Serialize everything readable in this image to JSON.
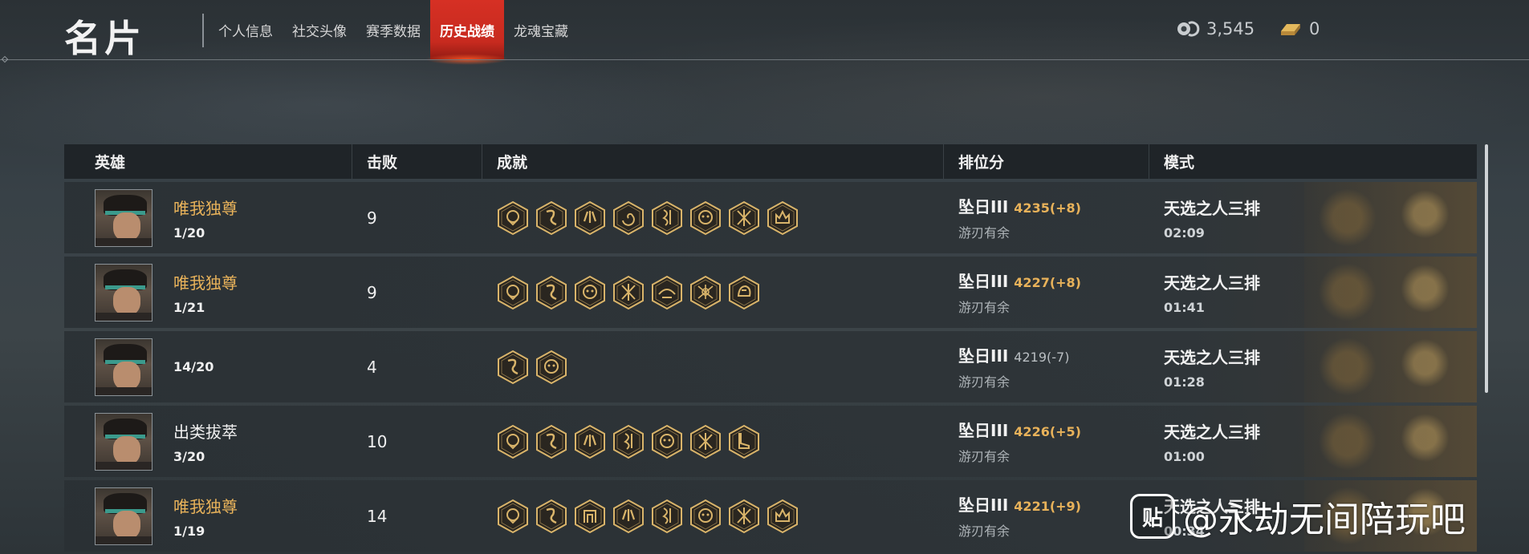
{
  "header": {
    "title": "名片",
    "tabs": [
      {
        "label": "个人信息",
        "active": false
      },
      {
        "label": "社交头像",
        "active": false
      },
      {
        "label": "赛季数据",
        "active": false
      },
      {
        "label": "历史战绩",
        "active": true
      },
      {
        "label": "龙魂宝藏",
        "active": false
      }
    ],
    "currency": {
      "jade": {
        "icon": "jade-coin-icon",
        "value": "3,545"
      },
      "gold": {
        "icon": "gold-ingot-icon",
        "value": "0"
      }
    }
  },
  "table": {
    "columns": {
      "hero": "英雄",
      "kills": "击败",
      "achievements": "成就",
      "rank": "排位分",
      "mode": "模式"
    },
    "rows": [
      {
        "title": "唯我独尊",
        "title_highlight": true,
        "placement": "1/20",
        "kills": "9",
        "badges": [
          "mask-badge-icon",
          "dragon-badge-icon",
          "claw-badge-icon",
          "swirl-badge-icon",
          "serpent-badge-icon",
          "beast-badge-icon",
          "cross-blades-badge-icon",
          "crown-badge-icon"
        ],
        "rank": "坠日III",
        "score": "4235(+8)",
        "score_up": true,
        "rank_sub": "游刃有余",
        "mode": "天选之人三排",
        "duration": "02:09"
      },
      {
        "title": "唯我独尊",
        "title_highlight": true,
        "placement": "1/21",
        "kills": "9",
        "badges": [
          "mask-badge-icon",
          "dragon-badge-icon",
          "beast-badge-icon",
          "cross-blades-badge-icon",
          "wings-badge-icon",
          "crossed-spears-badge-icon",
          "tiger-badge-icon"
        ],
        "rank": "坠日III",
        "score": "4227(+8)",
        "score_up": true,
        "rank_sub": "游刃有余",
        "mode": "天选之人三排",
        "duration": "01:41"
      },
      {
        "title": "",
        "title_highlight": false,
        "placement": "14/20",
        "kills": "4",
        "badges": [
          "dragon-badge-icon",
          "beast-badge-icon"
        ],
        "rank": "坠日III",
        "score": "4219(-7)",
        "score_up": false,
        "rank_sub": "游刃有余",
        "mode": "天选之人三排",
        "duration": "01:28"
      },
      {
        "title": "出类拔萃",
        "title_highlight": false,
        "placement": "3/20",
        "kills": "10",
        "badges": [
          "mask-badge-icon",
          "dragon-badge-icon",
          "claw-badge-icon",
          "serpent-badge-icon",
          "beast-badge-icon",
          "cross-blades-badge-icon",
          "boot-badge-icon"
        ],
        "rank": "坠日III",
        "score": "4226(+5)",
        "score_up": true,
        "rank_sub": "游刃有余",
        "mode": "天选之人三排",
        "duration": "01:00"
      },
      {
        "title": "唯我独尊",
        "title_highlight": true,
        "placement": "1/19",
        "kills": "14",
        "badges": [
          "mask-badge-icon",
          "dragon-badge-icon",
          "gate-badge-icon",
          "claw-badge-icon",
          "serpent-badge-icon",
          "beast-badge-icon",
          "cross-blades-badge-icon",
          "crown-badge-icon"
        ],
        "rank": "坠日III",
        "score": "4221(+9)",
        "score_up": true,
        "rank_sub": "游刃有余",
        "mode": "天选之人三排",
        "duration": "00:34"
      }
    ]
  },
  "watermark": {
    "logo": "贴",
    "text": "@永劫无间陪玩吧"
  },
  "colors": {
    "accent_red": "#d63024",
    "gold_text": "#e8b25a",
    "badge_gold": "#d9b46a"
  }
}
